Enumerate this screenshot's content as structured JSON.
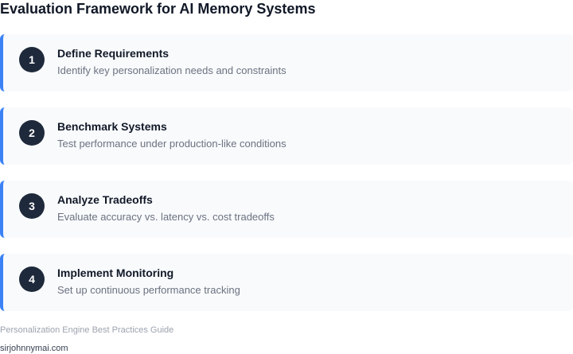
{
  "title": "Evaluation Framework for AI Memory Systems",
  "steps": [
    {
      "number": "1",
      "title": "Define Requirements",
      "description": "Identify key personalization needs and constraints"
    },
    {
      "number": "2",
      "title": "Benchmark Systems",
      "description": "Test performance under production-like conditions"
    },
    {
      "number": "3",
      "title": "Analyze Tradeoffs",
      "description": "Evaluate accuracy vs. latency vs. cost tradeoffs"
    },
    {
      "number": "4",
      "title": "Implement Monitoring",
      "description": "Set up continuous performance tracking"
    }
  ],
  "footer": {
    "caption": "Personalization Engine Best Practices Guide",
    "site": "sirjohnnymai.com"
  },
  "colors": {
    "accent": "#3b82f6",
    "badge": "#1e293b",
    "card_background": "#f8fafc"
  }
}
